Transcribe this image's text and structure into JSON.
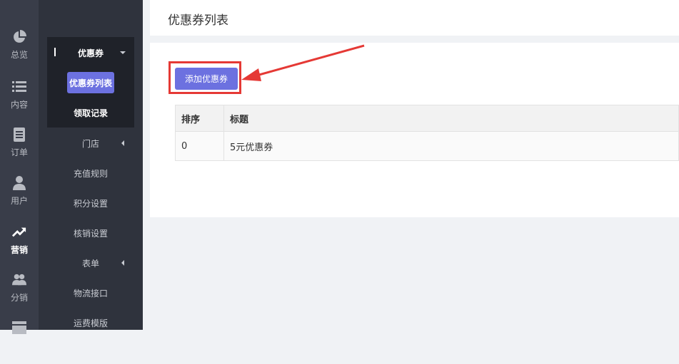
{
  "rail": {
    "items": [
      {
        "label": "总览",
        "icon": "pie-chart-icon"
      },
      {
        "label": "内容",
        "icon": "list-icon"
      },
      {
        "label": "订单",
        "icon": "document-icon"
      },
      {
        "label": "用户",
        "icon": "user-icon"
      },
      {
        "label": "营销",
        "icon": "trend-up-icon",
        "active": true
      },
      {
        "label": "分销",
        "icon": "users-icon"
      },
      {
        "label": "",
        "icon": "layout-icon"
      }
    ]
  },
  "sidebar": {
    "group_title": "优惠券",
    "active_item": "优惠券列表",
    "sub_item": "领取记录",
    "items": [
      {
        "label": "门店",
        "has_caret": true
      },
      {
        "label": "充值规则"
      },
      {
        "label": "积分设置"
      },
      {
        "label": "核销设置"
      },
      {
        "label": "表单",
        "has_caret": true
      },
      {
        "label": "物流接口"
      },
      {
        "label": "运费模版"
      }
    ]
  },
  "page": {
    "title": "优惠券列表",
    "add_button": "添加优惠券"
  },
  "table": {
    "headers": [
      "排序",
      "标题"
    ],
    "rows": [
      [
        "0",
        "5元优惠券"
      ]
    ]
  },
  "colors": {
    "accent": "#6c71e0",
    "annotation": "#e53935",
    "rail_bg": "#393d49",
    "sidebar_bg": "#2f333d"
  }
}
